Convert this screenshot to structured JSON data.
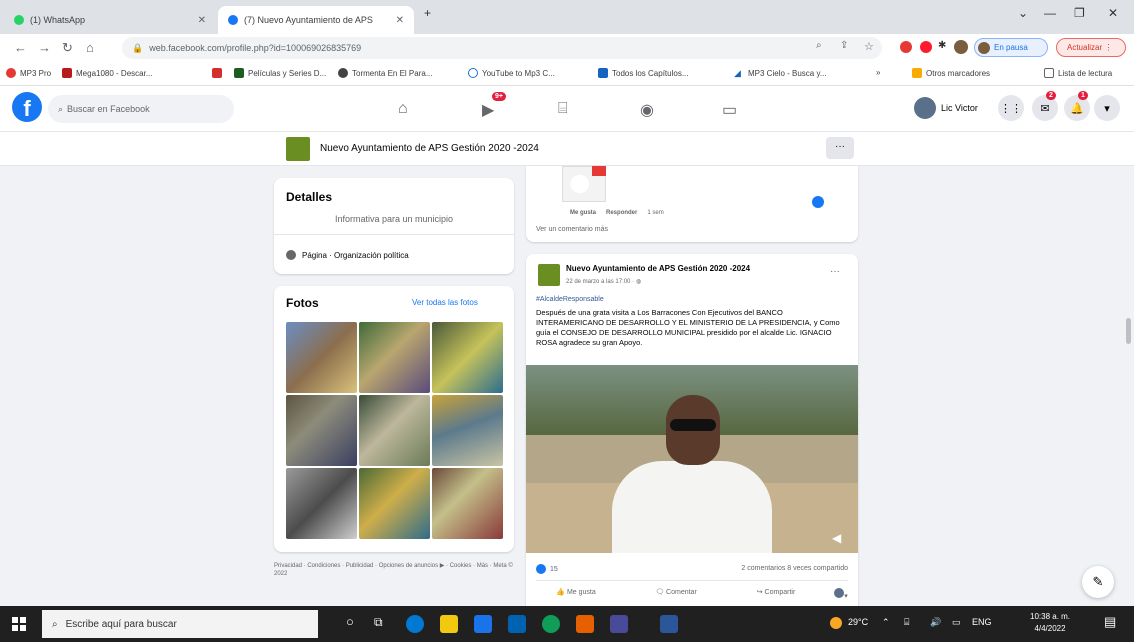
{
  "browser": {
    "tabs": [
      {
        "title": "(1) WhatsApp",
        "active": false
      },
      {
        "title": "(7) Nuevo Ayuntamiento de APS",
        "active": true
      }
    ],
    "url": "web.facebook.com/profile.php?id=100069026835769",
    "profile_label": "En pausa",
    "update_label": "Actualizar"
  },
  "bookmarks": {
    "items": [
      "MP3 Pro",
      "Mega1080 - Descar...",
      "",
      "Películas y Series D...",
      "Tormenta En El Para...",
      "YouTube to Mp3 C...",
      "Todos los Capítulos...",
      "MP3 Cielo - Busca y..."
    ],
    "other": "Otros marcadores",
    "reading_list": "Lista de lectura"
  },
  "facebook": {
    "search_placeholder": "Buscar en Facebook",
    "video_badge": "9+",
    "user_name": "Lic Victor",
    "messenger_badge": "2",
    "notif_badge": "1"
  },
  "page": {
    "title": "Nuevo Ayuntamiento de APS Gestión 2020 -2024",
    "more": "···"
  },
  "details": {
    "heading": "Detalles",
    "description": "Informativa para un municipio",
    "category": "Página · Organización política"
  },
  "photos": {
    "heading": "Fotos",
    "see_all": "Ver todas las fotos",
    "footer": "Privacidad · Condiciones · Publicidad · Opciones de anuncios ▶ · Cookies · Más · Meta © 2022"
  },
  "prev_post": {
    "like": "Me gusta",
    "reply": "Responder",
    "time": "1 sem",
    "more_comments": "Ver un comentario más"
  },
  "post": {
    "author": "Nuevo Ayuntamiento de APS Gestión 2020 -2024",
    "meta": "22 de marzo a las 17:00 · ",
    "hashtag": "#AlcaldeResponsable",
    "text": "Después de una grata visita a Los Barracones Con Ejecutivos del BANCO INTERAMERICANO DE DESARROLLO Y EL MINISTERIO DE LA PRESIDENCIA, y Como guía el CONSEJO DE DESARROLLO MUNICIPAL presidido por el alcalde Lic. IGNACIO ROSA agradece su gran Apoyo.",
    "reactions": "15",
    "stats": "2 comentarios  8 veces compartido",
    "like": "Me gusta",
    "comment": "Comentar",
    "share": "Compartir",
    "more": "···"
  },
  "taskbar": {
    "search": "Escribe aquí para buscar",
    "weather": "29°C",
    "lang": "ENG",
    "time": "10:38 a. m.",
    "date": "4/4/2022"
  }
}
